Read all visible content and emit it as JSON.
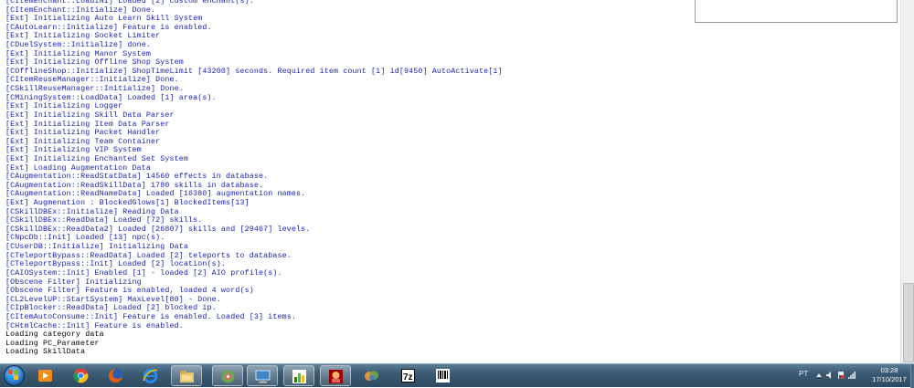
{
  "console": {
    "lines": [
      {
        "text": "[CItemEnchant::LoadINI] Loaded [2] custom enchant(s).",
        "color": "blue"
      },
      {
        "text": "[CItemEnchant::Initialize] Done.",
        "color": "blue"
      },
      {
        "text": "[Ext] Initializing Auto Learn Skill System",
        "color": "blue"
      },
      {
        "text": "[CAutoLearn::Initialize] Feature is enabled.",
        "color": "blue"
      },
      {
        "text": "[Ext] Initializing Socket Limiter",
        "color": "blue"
      },
      {
        "text": "[CDuelSystem::Initialize] done.",
        "color": "blue"
      },
      {
        "text": "[Ext] Initializing Manor System",
        "color": "blue"
      },
      {
        "text": "[Ext] Initializing Offline Shop System",
        "color": "blue"
      },
      {
        "text": "[COfflineShop::Initialize] ShopTimeLimit [43200] seconds. Required item count [1] id[9450] AutoActivate[1]",
        "color": "blue"
      },
      {
        "text": "[CItemReuseManager::Initialize] Done.",
        "color": "blue"
      },
      {
        "text": "[CSkillReuseManager::Initialize] Done.",
        "color": "blue"
      },
      {
        "text": "[CMiningSystem::LoadData] Loaded [1] area(s).",
        "color": "blue"
      },
      {
        "text": "[Ext] Initializing Logger",
        "color": "blue"
      },
      {
        "text": "[Ext] Initializing Skill Data Parser",
        "color": "blue"
      },
      {
        "text": "[Ext] Initializing Item Data Parser",
        "color": "blue"
      },
      {
        "text": "[Ext] Initializing Packet Handler",
        "color": "blue"
      },
      {
        "text": "[Ext] Initializing Team Container",
        "color": "blue"
      },
      {
        "text": "[Ext] Initializing VIP System",
        "color": "blue"
      },
      {
        "text": "[Ext] Initializing Enchanted Set System",
        "color": "blue"
      },
      {
        "text": "[Ext] Loading Augmentation Data",
        "color": "blue"
      },
      {
        "text": "[CAugmentation::ReadStatData] 14560 effects in database.",
        "color": "blue"
      },
      {
        "text": "[CAugmentation::ReadSkillData] 1780 skills in database.",
        "color": "blue"
      },
      {
        "text": "[CAugmentation::ReadNameData] Loaded [16380] augmentation names.",
        "color": "blue"
      },
      {
        "text": "[Ext] Augmenation : BlockedGlows[1] BlockedItems[13]",
        "color": "blue"
      },
      {
        "text": "[CSkillDBEx::Initialize] Reading Data",
        "color": "blue"
      },
      {
        "text": "[CSkillDBEx::ReadData] Loaded [72] skills.",
        "color": "blue"
      },
      {
        "text": "[CSkillDBEx::ReadData2] Loaded [26807] skills and [29467] levels.",
        "color": "blue"
      },
      {
        "text": "[CNpcDb::Init] Loaded [13] npc(s).",
        "color": "blue"
      },
      {
        "text": "[CUserDB::Initialize] Initializing Data",
        "color": "blue"
      },
      {
        "text": "[CTeleportBypass::ReadData] Loaded [2] teleports to database.",
        "color": "blue"
      },
      {
        "text": "[CTeleportBypass::Init] Loaded [2] location(s).",
        "color": "blue"
      },
      {
        "text": "[CAIOSystem::Init] Enabled [1] - loaded [2] AIO profile(s).",
        "color": "blue"
      },
      {
        "text": "[Obscene Filter] Initializing",
        "color": "blue"
      },
      {
        "text": "[Obscene Filter] Feature is enabled, loaded 4 word(s)",
        "color": "blue"
      },
      {
        "text": "[CL2LevelUP::StartSystem] MaxLevel[80] - Done.",
        "color": "blue"
      },
      {
        "text": "[CIpBlocker::ReadData] Loaded [2] blocked ip.",
        "color": "blue"
      },
      {
        "text": "[CItemAutoConsume::Init] Feature is enabled. Loaded [3] items.",
        "color": "blue"
      },
      {
        "text": "[CHtmlCache::Init] Feature is enabled.",
        "color": "blue"
      },
      {
        "text": "Loading category data",
        "color": "black"
      },
      {
        "text": "Loading PC_Parameter",
        "color": "black"
      },
      {
        "text": "Loading SkillData",
        "color": "black"
      }
    ]
  },
  "taskbar": {
    "icons": [
      {
        "name": "media-player-icon",
        "active": false
      },
      {
        "name": "chrome-icon",
        "active": false
      },
      {
        "name": "firefox-icon",
        "active": false
      },
      {
        "name": "internet-explorer-icon",
        "active": false
      },
      {
        "name": "file-explorer-icon",
        "active": true
      },
      {
        "name": "network-tool-icon",
        "active": true
      },
      {
        "name": "remote-desktop-icon",
        "active": true
      },
      {
        "name": "chart-app-icon",
        "active": true
      },
      {
        "name": "game-launcher-icon",
        "active": true
      },
      {
        "name": "messenger-icon",
        "active": false
      },
      {
        "name": "7zip-icon",
        "active": false
      },
      {
        "name": "barcode-app-icon",
        "active": false
      }
    ],
    "tray": {
      "language": "PT",
      "time": "03:28",
      "date": "17/10/2017"
    }
  }
}
